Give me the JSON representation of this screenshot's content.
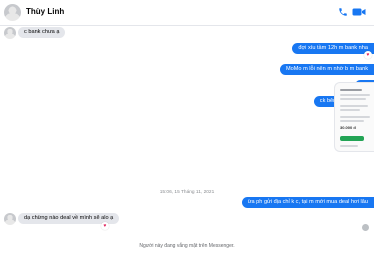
{
  "header": {
    "contact_name": "Thùy Linh",
    "icons": [
      "avatar",
      "phone-icon",
      "video-icon"
    ],
    "accent_color": "#1877f2"
  },
  "messages": [
    {
      "direction": "incoming",
      "text": "c bank chưa ạ"
    },
    {
      "direction": "outgoing",
      "text": "đợi xíu tầm 12h m bank nha",
      "reaction": "heart"
    },
    {
      "direction": "outgoing",
      "text": "MoMo m lỗi nên m nhờ b m bank"
    },
    {
      "direction": "outgoing",
      "text": "o c"
    },
    {
      "direction": "outgoing",
      "text": "ck bên tech k dc 30"
    },
    {
      "direction": "outgoing",
      "type": "image",
      "text": "30.000 đ"
    },
    {
      "direction": "outgoing",
      "text": "ừa ph gửi địa chỉ k c, tại m mới mua deal hơi lâu"
    },
    {
      "direction": "incoming",
      "text": "dạ chừng nào deal về mình sẽ alo ạ",
      "reaction": "heart"
    }
  ],
  "timestamp": "15:06, 15 Tháng 11, 2021",
  "footer_status": "Người này đang vắng mặt trên Messenger."
}
